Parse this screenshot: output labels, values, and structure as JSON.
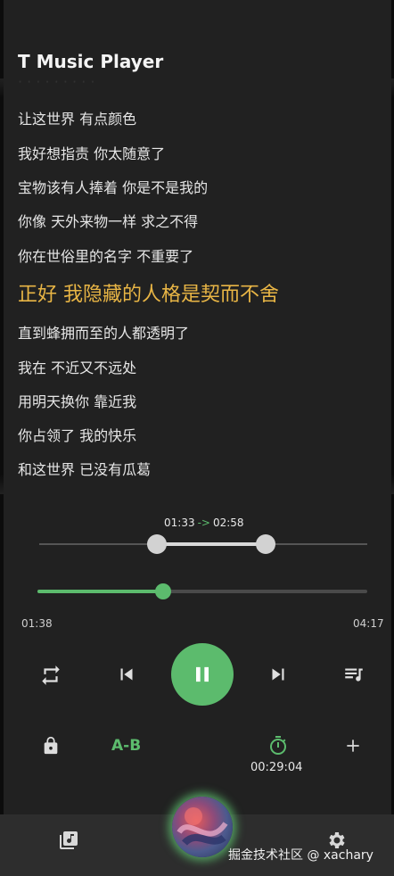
{
  "app": {
    "title": "T Music Player"
  },
  "lyrics": {
    "lines": [
      "让这世界 有点颜色",
      "我好想指责 你太随意了",
      "宝物该有人捧着 你是不是我的",
      "你像 天外来物一样 求之不得",
      "你在世俗里的名字 不重要了",
      "正好 我隐藏的人格是契而不舍",
      "直到蜂拥而至的人都透明了",
      "我在 不近又不远处",
      "用明天换你 靠近我",
      "你占领了 我的快乐",
      "和这世界 已没有瓜葛"
    ],
    "active_index": 5
  },
  "ab_repeat": {
    "start": "01:33",
    "arrow": "->",
    "end": "02:58",
    "start_fraction": 0.356,
    "end_fraction": 0.688
  },
  "progress": {
    "current": "01:38",
    "total": "04:17",
    "fraction": 0.38
  },
  "controls": {
    "repeat_icon": "repeat-icon",
    "previous_icon": "skip-previous-icon",
    "play_pause_icon": "pause-icon",
    "next_icon": "skip-next-icon",
    "queue_icon": "playlist-icon"
  },
  "secondary": {
    "lock_icon": "lock-icon",
    "ab_label": "A-B",
    "timer_icon": "timer-icon",
    "timer_value": "00:29:04",
    "add_icon": "plus-icon"
  },
  "bottom_nav": {
    "library_icon": "music-library-icon",
    "settings_icon": "gear-icon",
    "watermark": "掘金技术社区 @ xachary"
  },
  "colors": {
    "accent": "#5cbb6d",
    "highlight_lyric": "#e8b545",
    "background": "#212121"
  }
}
